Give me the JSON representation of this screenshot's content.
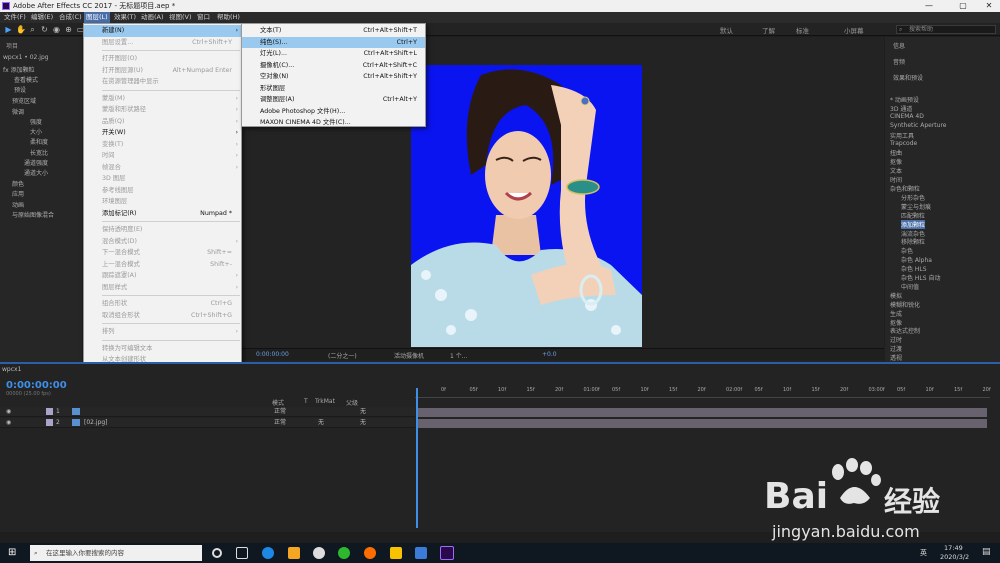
{
  "window": {
    "title": "Adobe After Effects CC 2017 - 无标题项目.aep *",
    "minimize": "—",
    "maximize": "▢",
    "close": "✕"
  },
  "menubar": [
    "文件(F)",
    "编辑(E)",
    "合成(C)",
    "图层(L)",
    "效果(T)",
    "动画(A)",
    "视图(V)",
    "窗口",
    "帮助(H)"
  ],
  "toolbar": {
    "workspaces": [
      "默认",
      "了解",
      "标准",
      "小屏幕"
    ],
    "search_placeholder": "搜索帮助"
  },
  "project_panel": {
    "tab": "项目",
    "comp_name": "wpcx1 • 02.jpg",
    "rows": [
      "fx 添加颗粒",
      "查看模式",
      "预设",
      "预览区域",
      "微调",
      "强度",
      "大小",
      "柔和度",
      "长宽比",
      "通道强度",
      "通道大小",
      "颜色",
      "应用",
      "动画",
      "与原始图像混合"
    ]
  },
  "layer_menu": {
    "items": [
      {
        "label": "新建(N)",
        "shortcut": "",
        "submenu": true,
        "enabled": true,
        "highlighted": true
      },
      {
        "label": "图层设置...",
        "shortcut": "Ctrl+Shift+Y",
        "enabled": false
      },
      {
        "sep": true
      },
      {
        "label": "打开图层(O)",
        "shortcut": "",
        "enabled": false
      },
      {
        "label": "打开图层源(U)",
        "shortcut": "Alt+Numpad Enter",
        "enabled": false
      },
      {
        "label": "在资源管理器中显示",
        "shortcut": "",
        "enabled": false
      },
      {
        "sep": true
      },
      {
        "label": "蒙版(M)",
        "shortcut": "",
        "submenu": true,
        "enabled": false
      },
      {
        "label": "蒙版和形状路径",
        "shortcut": "",
        "submenu": true,
        "enabled": false
      },
      {
        "label": "品质(Q)",
        "shortcut": "",
        "submenu": true,
        "enabled": false
      },
      {
        "label": "开关(W)",
        "shortcut": "",
        "submenu": true,
        "enabled": true
      },
      {
        "label": "变换(T)",
        "shortcut": "",
        "submenu": true,
        "enabled": false
      },
      {
        "label": "时间",
        "shortcut": "",
        "submenu": true,
        "enabled": false
      },
      {
        "label": "帧混合",
        "shortcut": "",
        "submenu": true,
        "enabled": false
      },
      {
        "label": "3D 图层",
        "shortcut": "",
        "enabled": false
      },
      {
        "label": "参考线图层",
        "shortcut": "",
        "enabled": false
      },
      {
        "label": "环境图层",
        "shortcut": "",
        "enabled": false
      },
      {
        "label": "添加标记(R)",
        "shortcut": "Numpad *",
        "enabled": true
      },
      {
        "sep": true
      },
      {
        "label": "保持透明度(E)",
        "shortcut": "",
        "enabled": false
      },
      {
        "label": "混合模式(D)",
        "shortcut": "",
        "submenu": true,
        "enabled": false
      },
      {
        "label": "下一混合模式",
        "shortcut": "Shift+=",
        "enabled": false
      },
      {
        "label": "上一混合模式",
        "shortcut": "Shift+-",
        "enabled": false
      },
      {
        "label": "跟踪遮罩(A)",
        "shortcut": "",
        "submenu": true,
        "enabled": false
      },
      {
        "label": "图层样式",
        "shortcut": "",
        "submenu": true,
        "enabled": false
      },
      {
        "sep": true
      },
      {
        "label": "组合形状",
        "shortcut": "Ctrl+G",
        "enabled": false
      },
      {
        "label": "取消组合形状",
        "shortcut": "Ctrl+Shift+G",
        "enabled": false
      },
      {
        "sep": true
      },
      {
        "label": "排列",
        "shortcut": "",
        "submenu": true,
        "enabled": false
      },
      {
        "sep": true
      },
      {
        "label": "转换为可编辑文本",
        "shortcut": "",
        "enabled": false
      },
      {
        "label": "从文本创建形状",
        "shortcut": "",
        "enabled": false
      },
      {
        "label": "从文本创建蒙版",
        "shortcut": "",
        "enabled": false
      },
      {
        "label": "从矢量图层创建形状",
        "shortcut": "",
        "enabled": false
      },
      {
        "sep": true
      },
      {
        "label": "摄像机",
        "shortcut": "",
        "submenu": true,
        "enabled": true
      },
      {
        "label": "自动追踪...",
        "shortcut": "",
        "enabled": false
      },
      {
        "label": "预合成(P)...",
        "shortcut": "Ctrl+Shift+C",
        "enabled": false
      }
    ]
  },
  "new_submenu": {
    "items": [
      {
        "label": "文本(T)",
        "shortcut": "Ctrl+Alt+Shift+T"
      },
      {
        "label": "纯色(S)...",
        "shortcut": "Ctrl+Y",
        "highlighted": true
      },
      {
        "label": "灯光(L)...",
        "shortcut": "Ctrl+Alt+Shift+L"
      },
      {
        "label": "摄像机(C)...",
        "shortcut": "Ctrl+Alt+Shift+C"
      },
      {
        "label": "空对象(N)",
        "shortcut": "Ctrl+Alt+Shift+Y"
      },
      {
        "label": "形状图层",
        "shortcut": ""
      },
      {
        "label": "调整图层(A)",
        "shortcut": "Ctrl+Alt+Y"
      },
      {
        "label": "Adobe Photoshop 文件(H)...",
        "shortcut": ""
      },
      {
        "label": "MAXON CINEMA 4D 文件(C)...",
        "shortcut": ""
      }
    ]
  },
  "effects_panel": {
    "tabs": [
      "信息",
      "音频",
      "效果和预设"
    ],
    "items": [
      "* 动画预设",
      "3D 通道",
      "CINEMA 4D",
      "Synthetic Aperture",
      "实用工具",
      "Trapcode",
      "扭曲",
      "抠像",
      "文本",
      "时间",
      "杂色和颗粒",
      "分形杂色",
      "蒙尘与划痕",
      "匹配颗粒",
      "添加颗粒",
      "湍流杂色",
      "移除颗粒",
      "杂色",
      "杂色 Alpha",
      "杂色 HLS",
      "杂色 HLS 自动",
      "中间值",
      "模拟",
      "模糊和锐化",
      "生成",
      "抠像",
      "表达式控制",
      "过时",
      "过渡",
      "透视"
    ]
  },
  "comp_footer": {
    "timecode": "0:00:00:00",
    "resolution": "(二分之一)",
    "camera": "活动摄像机",
    "views": "1 个...",
    "exposure": "+0.0"
  },
  "timeline": {
    "tab": "wpcx1",
    "timecode": "0:00:00:00",
    "timecode_sub": "00000 (25.00 fps)",
    "columns": {
      "mode": "模式",
      "t": "T",
      "trkmat": "TrkMat",
      "parent": "父级"
    },
    "layers": [
      {
        "num": "1",
        "name": "",
        "mode": "正常",
        "trkmat": "",
        "parent": "无"
      },
      {
        "num": "2",
        "name": "[02.jpg]",
        "mode": "正常",
        "trkmat": "无",
        "parent": "无"
      }
    ],
    "ruler": [
      "0f",
      "05f",
      "10f",
      "15f",
      "20f",
      "01:00f",
      "05f",
      "10f",
      "15f",
      "20f",
      "02:00f",
      "05f",
      "10f",
      "15f",
      "20f",
      "03:00f",
      "05f",
      "10f",
      "15f",
      "20f"
    ]
  },
  "taskbar": {
    "search": "在这里输入你要搜索的内容",
    "time": "17:49",
    "date": "2020/3/2",
    "lang": "英"
  },
  "watermark": {
    "brand": "Bai",
    "brand2": "经验",
    "url": "jingyan.baidu.com"
  },
  "colors": {
    "accent": "#3f8fe8",
    "canvas_bg": "#0a14f0",
    "menu_highlight": "#99c9ef",
    "timeline_border": "#2d5fa8"
  }
}
